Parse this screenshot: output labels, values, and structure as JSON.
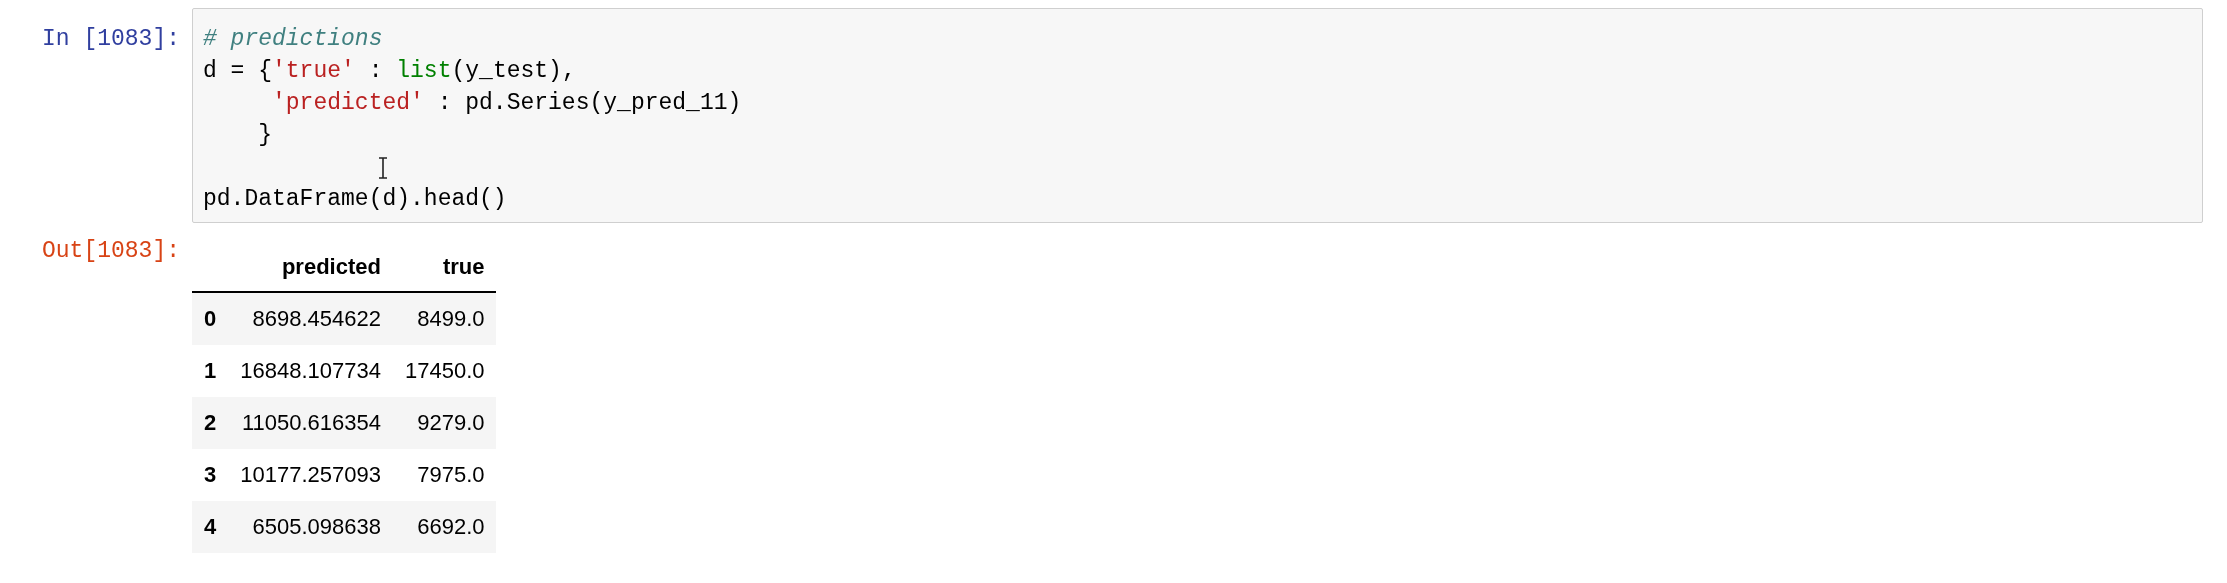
{
  "input_cell": {
    "prompt": "In [1083]:",
    "lines": [
      [
        {
          "kind": "comment",
          "text": "# predictions"
        }
      ],
      [
        {
          "kind": "plain",
          "text": "d = {"
        },
        {
          "kind": "string",
          "text": "'true'"
        },
        {
          "kind": "plain",
          "text": " : "
        },
        {
          "kind": "builtin",
          "text": "list"
        },
        {
          "kind": "plain",
          "text": "(y_test),"
        }
      ],
      [
        {
          "kind": "string",
          "text": "     'predicted'"
        },
        {
          "kind": "plain",
          "text": " : pd.Series(y_pred_11)"
        }
      ],
      [
        {
          "kind": "plain",
          "text": "    }"
        }
      ],
      [
        {
          "kind": "blank"
        }
      ],
      [
        {
          "kind": "plain",
          "text": "pd.DataFrame(d).head()"
        }
      ]
    ]
  },
  "output_cell": {
    "prompt": "Out[1083]:",
    "table": {
      "columns": [
        "predicted",
        "true"
      ],
      "rows": [
        {
          "index": "0",
          "cells": [
            "8698.454622",
            "8499.0"
          ]
        },
        {
          "index": "1",
          "cells": [
            "16848.107734",
            "17450.0"
          ]
        },
        {
          "index": "2",
          "cells": [
            "11050.616354",
            "9279.0"
          ]
        },
        {
          "index": "3",
          "cells": [
            "10177.257093",
            "7975.0"
          ]
        },
        {
          "index": "4",
          "cells": [
            "6505.098638",
            "6692.0"
          ]
        }
      ]
    }
  }
}
